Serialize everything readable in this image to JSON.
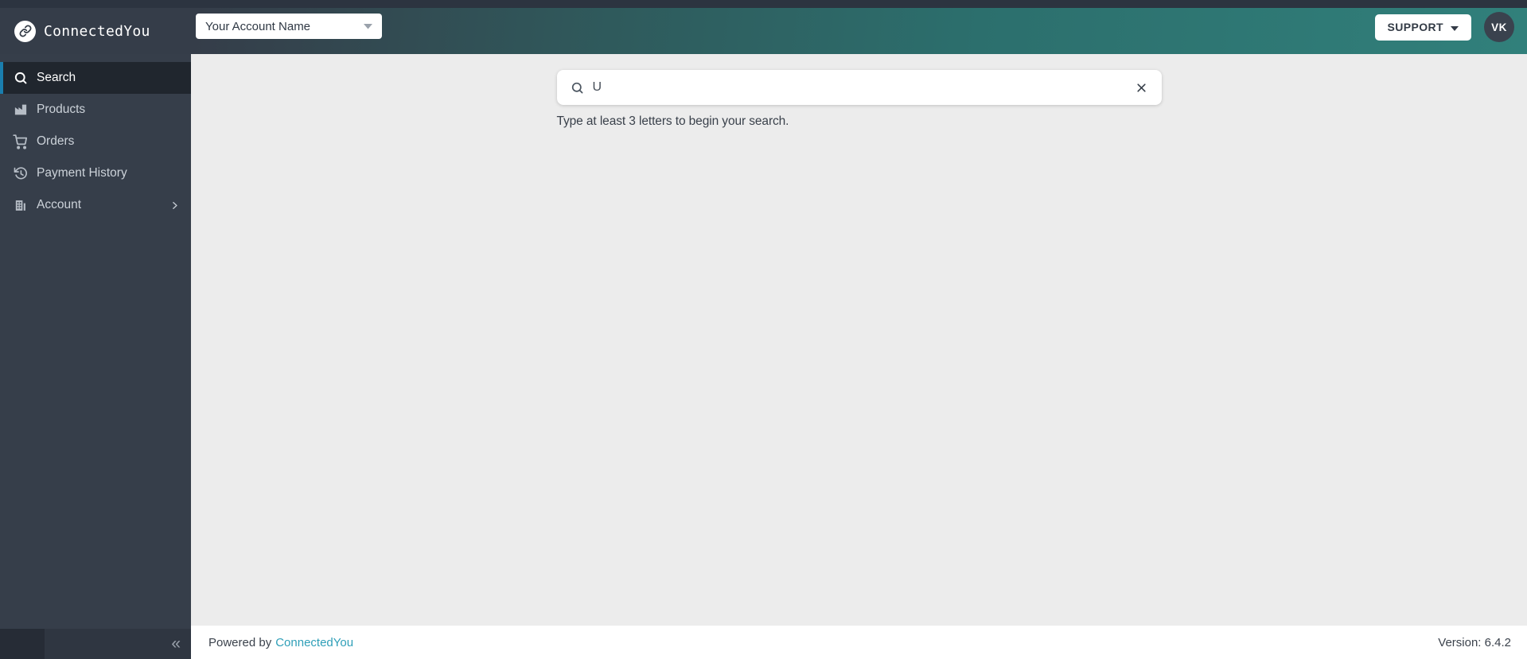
{
  "brand": {
    "name": "ConnectedYou",
    "logo_icon": "link-icon"
  },
  "header": {
    "account_selector": {
      "value": "Your Account Name",
      "caret_icon": "chevron-down-icon"
    },
    "support": {
      "label": "SUPPORT",
      "caret_icon": "chevron-down-icon"
    },
    "avatar": {
      "initials": "VK"
    }
  },
  "sidebar": {
    "items": [
      {
        "label": "Search",
        "icon": "search-icon",
        "active": true
      },
      {
        "label": "Products",
        "icon": "factory-icon",
        "active": false
      },
      {
        "label": "Orders",
        "icon": "cart-icon",
        "active": false
      },
      {
        "label": "Payment History",
        "icon": "history-icon",
        "active": false
      },
      {
        "label": "Account",
        "icon": "building-icon",
        "active": false,
        "has_submenu": true
      }
    ],
    "collapse_glyph": "«"
  },
  "main": {
    "search": {
      "value": "U",
      "hint": "Type at least 3 letters to begin your search.",
      "search_icon": "search-icon",
      "clear_icon": "close-icon"
    }
  },
  "footer": {
    "powered_by_prefix": "Powered by",
    "brand_link": "ConnectedYou",
    "version": "Version: 6.4.2"
  },
  "colors": {
    "topbar_strip": "#2c3440",
    "header_gradient_start": "#353d49",
    "header_gradient_end": "#31807b",
    "sidebar_bg": "#363e4a",
    "sidebar_active_bg": "#20262e",
    "sidebar_accent_blue": "#1a7eae",
    "content_bg": "#ececec",
    "link_teal": "#2f9fb8",
    "dark_text": "#333b46",
    "avatar_bg": "#3a424e"
  }
}
